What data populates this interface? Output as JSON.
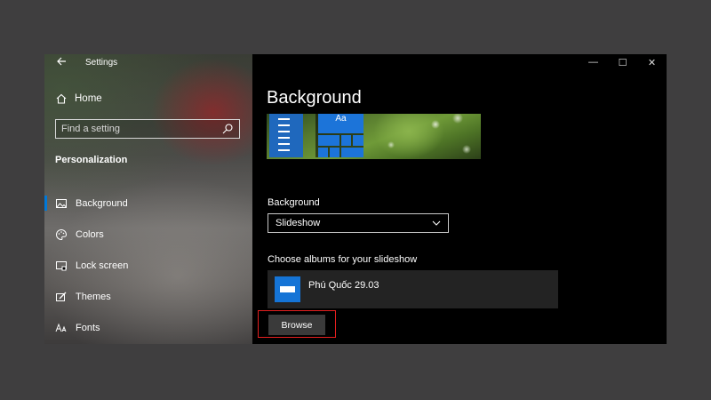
{
  "window": {
    "app_title": "Settings",
    "controls": {
      "minimize": "—",
      "maximize": "☐",
      "close": "✕"
    }
  },
  "sidebar": {
    "back_icon": "back-arrow-icon",
    "home_label": "Home",
    "search": {
      "placeholder": "Find a setting",
      "value": ""
    },
    "section_title": "Personalization",
    "items": [
      {
        "label": "Background",
        "icon": "picture-icon",
        "active": true
      },
      {
        "label": "Colors",
        "icon": "palette-icon",
        "active": false
      },
      {
        "label": "Lock screen",
        "icon": "lock-screen-icon",
        "active": false
      },
      {
        "label": "Themes",
        "icon": "themes-icon",
        "active": false
      },
      {
        "label": "Fonts",
        "icon": "fonts-icon",
        "active": false
      }
    ]
  },
  "main": {
    "page_title": "Background",
    "preview": {
      "tile_text": "Aa"
    },
    "background_label": "Background",
    "background_value": "Slideshow",
    "albums_label": "Choose albums for your slideshow",
    "album_name": "Phú Quốc 29.03",
    "browse_label": "Browse"
  },
  "colors": {
    "accent": "#0078d7",
    "highlight": "#e41f1f",
    "window_bg": "#000000",
    "desktop_bg": "#3f3e3f"
  }
}
